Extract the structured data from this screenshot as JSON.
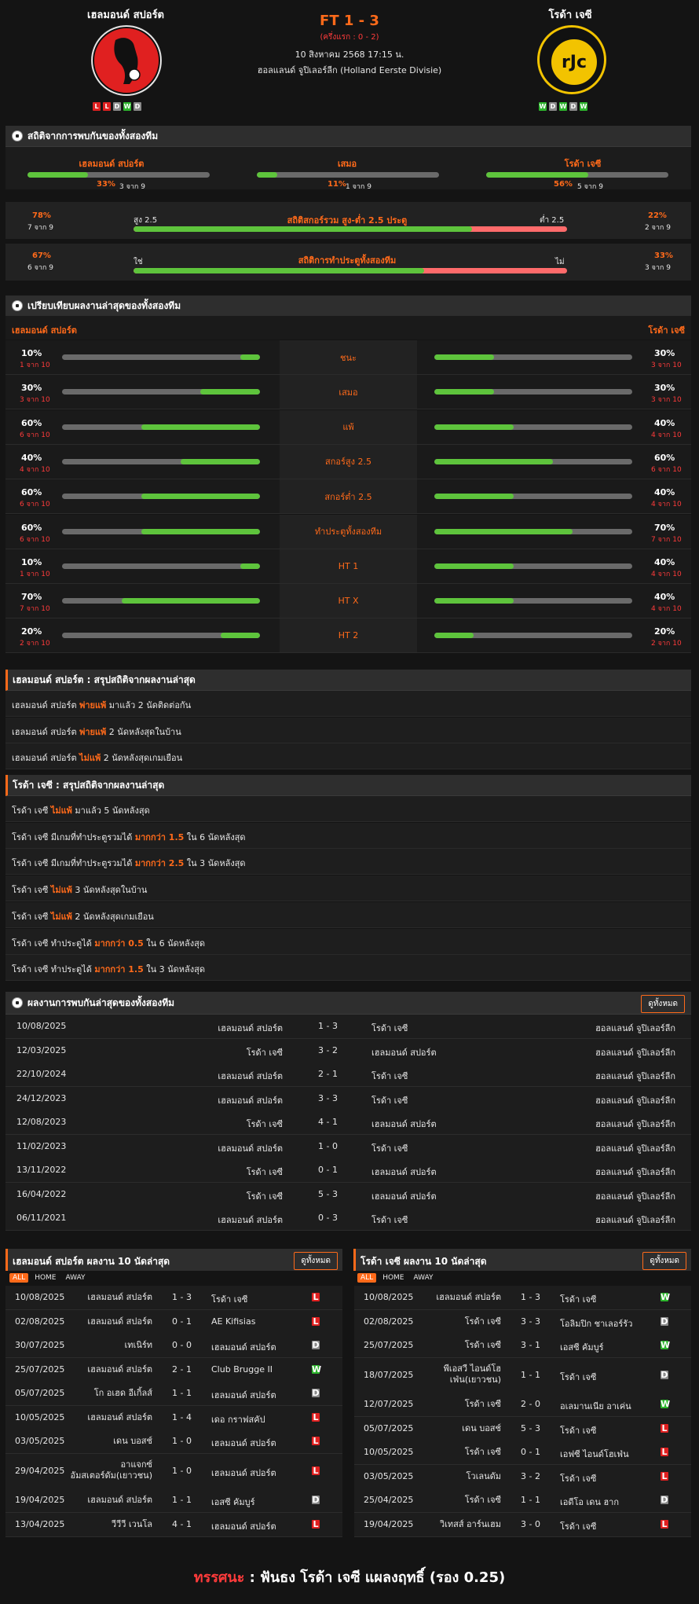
{
  "header": {
    "home": "เฮลมอนด์ สปอร์ต",
    "away": "โรด้า เจซี",
    "score": "FT 1 - 3",
    "half": "(ครึ่งแรก : 0 - 2)",
    "datetime": "10 สิงหาคม 2568 17:15 น.",
    "league": "ฮอลแลนด์ จูปิเลอร์ลีก (Holland Eerste Divisie)",
    "home_form": [
      "L",
      "L",
      "D",
      "W",
      "D"
    ],
    "away_form": [
      "W",
      "D",
      "W",
      "D",
      "W"
    ],
    "away_logo_text": "rJc"
  },
  "h2h": {
    "title": "สถิติจากการพบกันของทั้งสองทีม",
    "home_label": "เฮลมอนด์ สปอร์ต",
    "draw_label": "เสมอ",
    "away_label": "โรด้า เจซี",
    "home_pct": "33%",
    "home_of": "3 จาก 9",
    "home_val": 0.33,
    "draw_pct": "11%",
    "draw_of": "1 จาก 9",
    "draw_val": 0.11,
    "away_pct": "56%",
    "away_of": "5 จาก 9",
    "away_val": 0.56,
    "ou": {
      "left_pct": "78%",
      "left_of": "7 จาก 9",
      "over": "สูง 2.5",
      "title": "สถิติสกอร์รวม สูง-ต่ำ 2.5 ประตู",
      "under": "ต่ำ 2.5",
      "right_pct": "22%",
      "right_of": "2 จาก 9",
      "val": 0.78
    },
    "btts": {
      "left_pct": "67%",
      "left_of": "6 จาก 9",
      "yes": "ใช่",
      "title": "สถิติการทำประตูทั้งสองทีม",
      "no": "ไม่",
      "right_pct": "33%",
      "right_of": "3 จาก 9",
      "val": 0.67
    }
  },
  "compare": {
    "title": "เปรียบเทียบผลงานล่าสุดของทั้งสองทีม",
    "home": "เฮลมอนด์ สปอร์ต",
    "away": "โรด้า เจซี",
    "rows": [
      {
        "label": "ชนะ",
        "hp": "10%",
        "ho": "1 จาก 10",
        "hv": 0.1,
        "ap": "30%",
        "ao": "3 จาก 10",
        "av": 0.3
      },
      {
        "label": "เสมอ",
        "hp": "30%",
        "ho": "3 จาก 10",
        "hv": 0.3,
        "ap": "30%",
        "ao": "3 จาก 10",
        "av": 0.3
      },
      {
        "label": "แพ้",
        "hp": "60%",
        "ho": "6 จาก 10",
        "hv": 0.6,
        "ap": "40%",
        "ao": "4 จาก 10",
        "av": 0.4
      },
      {
        "label": "สกอร์สูง 2.5",
        "hp": "40%",
        "ho": "4 จาก 10",
        "hv": 0.4,
        "ap": "60%",
        "ao": "6 จาก 10",
        "av": 0.6
      },
      {
        "label": "สกอร์ต่ำ 2.5",
        "hp": "60%",
        "ho": "6 จาก 10",
        "hv": 0.6,
        "ap": "40%",
        "ao": "4 จาก 10",
        "av": 0.4
      },
      {
        "label": "ทำประตูทั้งสองทีม",
        "hp": "60%",
        "ho": "6 จาก 10",
        "hv": 0.6,
        "ap": "70%",
        "ao": "7 จาก 10",
        "av": 0.7
      },
      {
        "label": "HT 1",
        "hp": "10%",
        "ho": "1 จาก 10",
        "hv": 0.1,
        "ap": "40%",
        "ao": "4 จาก 10",
        "av": 0.4
      },
      {
        "label": "HT X",
        "hp": "70%",
        "ho": "7 จาก 10",
        "hv": 0.7,
        "ap": "40%",
        "ao": "4 จาก 10",
        "av": 0.4
      },
      {
        "label": "HT 2",
        "hp": "20%",
        "ho": "2 จาก 10",
        "hv": 0.2,
        "ap": "20%",
        "ao": "2 จาก 10",
        "av": 0.2
      }
    ]
  },
  "home_summary": {
    "title": "เฮลมอนด์ สปอร์ต : สรุปสถิติจากผลงานล่าสุด",
    "rows": [
      [
        "เฮลมอนด์ สปอร์ต ",
        "พ่ายแพ้",
        " มาแล้ว 2 นัดติดต่อกัน"
      ],
      [
        "เฮลมอนด์ สปอร์ต ",
        "พ่ายแพ้",
        " 2 นัดหลังสุดในบ้าน"
      ],
      [
        "เฮลมอนด์ สปอร์ต ",
        "ไม่แพ้",
        " 2 นัดหลังสุดเกมเยือน"
      ]
    ]
  },
  "away_summary": {
    "title": "โรด้า เจซี : สรุปสถิติจากผลงานล่าสุด",
    "rows": [
      [
        "โรด้า เจซี ",
        "ไม่แพ้",
        " มาแล้ว 5 นัดหลังสุด"
      ],
      [
        "โรด้า เจซี มีเกมที่ทำประตูรวมได้ ",
        "มากกว่า 1.5",
        " ใน 6 นัดหลังสุด"
      ],
      [
        "โรด้า เจซี มีเกมที่ทำประตูรวมได้ ",
        "มากกว่า 2.5",
        " ใน 3 นัดหลังสุด"
      ],
      [
        "โรด้า เจซี ",
        "ไม่แพ้",
        " 3 นัดหลังสุดในบ้าน"
      ],
      [
        "โรด้า เจซี ",
        "ไม่แพ้",
        " 2 นัดหลังสุดเกมเยือน"
      ],
      [
        "โรด้า เจซี ทำประตูได้ ",
        "มากกว่า 0.5",
        " ใน 6 นัดหลังสุด"
      ],
      [
        "โรด้า เจซี ทำประตูได้ ",
        "มากกว่า 1.5",
        " ใน 3 นัดหลังสุด"
      ]
    ]
  },
  "meetings": {
    "title": "ผลงานการพบกันล่าสุดของทั้งสองทีม",
    "view_all": "ดูทั้งหมด",
    "rows": [
      [
        "10/08/2025",
        "เฮลมอนด์ สปอร์ต",
        "1 - 3",
        "โรด้า เจซี",
        "ฮอลแลนด์ จูปิเลอร์ลีก"
      ],
      [
        "12/03/2025",
        "โรด้า เจซี",
        "3 - 2",
        "เฮลมอนด์ สปอร์ต",
        "ฮอลแลนด์ จูปิเลอร์ลีก"
      ],
      [
        "22/10/2024",
        "เฮลมอนด์ สปอร์ต",
        "2 - 1",
        "โรด้า เจซี",
        "ฮอลแลนด์ จูปิเลอร์ลีก"
      ],
      [
        "24/12/2023",
        "เฮลมอนด์ สปอร์ต",
        "3 - 3",
        "โรด้า เจซี",
        "ฮอลแลนด์ จูปิเลอร์ลีก"
      ],
      [
        "12/08/2023",
        "โรด้า เจซี",
        "4 - 1",
        "เฮลมอนด์ สปอร์ต",
        "ฮอลแลนด์ จูปิเลอร์ลีก"
      ],
      [
        "11/02/2023",
        "เฮลมอนด์ สปอร์ต",
        "1 - 0",
        "โรด้า เจซี",
        "ฮอลแลนด์ จูปิเลอร์ลีก"
      ],
      [
        "13/11/2022",
        "โรด้า เจซี",
        "0 - 1",
        "เฮลมอนด์ สปอร์ต",
        "ฮอลแลนด์ จูปิเลอร์ลีก"
      ],
      [
        "16/04/2022",
        "โรด้า เจซี",
        "5 - 3",
        "เฮลมอนด์ สปอร์ต",
        "ฮอลแลนด์ จูปิเลอร์ลีก"
      ],
      [
        "06/11/2021",
        "เฮลมอนด์ สปอร์ต",
        "0 - 3",
        "โรด้า เจซี",
        "ฮอลแลนด์ จูปิเลอร์ลีก"
      ]
    ]
  },
  "home_last": {
    "title": "เฮลมอนด์ สปอร์ต ผลงาน 10 นัดล่าสุด",
    "view_all": "ดูทั้งหมด",
    "tabs": [
      "ALL",
      "HOME",
      "AWAY"
    ],
    "rows": [
      [
        "10/08/2025",
        "เฮลมอนด์ สปอร์ต",
        "1 - 3",
        "โรด้า เจซี",
        "L"
      ],
      [
        "02/08/2025",
        "เฮลมอนด์ สปอร์ต",
        "0 - 1",
        "AE Kifisias",
        "L"
      ],
      [
        "30/07/2025",
        "เทเนิร์ท",
        "0 - 0",
        "เฮลมอนด์ สปอร์ต",
        "D"
      ],
      [
        "25/07/2025",
        "เฮลมอนด์ สปอร์ต",
        "2 - 1",
        "Club Brugge II",
        "W"
      ],
      [
        "05/07/2025",
        "โก อเฮด อีเกิ้ลส์",
        "1 - 1",
        "เฮลมอนด์ สปอร์ต",
        "D"
      ],
      [
        "10/05/2025",
        "เฮลมอนด์ สปอร์ต",
        "1 - 4",
        "เดอ กราฟสคัป",
        "L"
      ],
      [
        "03/05/2025",
        "เดน บอสช์",
        "1 - 0",
        "เฮลมอนด์ สปอร์ต",
        "L"
      ],
      [
        "29/04/2025",
        "อาแจกซ์ อัมสเตอร์ดัม(เยาวชน)",
        "1 - 0",
        "เฮลมอนด์ สปอร์ต",
        "L"
      ],
      [
        "19/04/2025",
        "เฮลมอนด์ สปอร์ต",
        "1 - 1",
        "เอสซี คัมบูร์",
        "D"
      ],
      [
        "13/04/2025",
        "วีวีวี เวนโล",
        "4 - 1",
        "เฮลมอนด์ สปอร์ต",
        "L"
      ]
    ]
  },
  "away_last": {
    "title": "โรด้า เจซี ผลงาน 10 นัดล่าสุด",
    "view_all": "ดูทั้งหมด",
    "tabs": [
      "ALL",
      "HOME",
      "AWAY"
    ],
    "rows": [
      [
        "10/08/2025",
        "เฮลมอนด์ สปอร์ต",
        "1 - 3",
        "โรด้า เจซี",
        "W"
      ],
      [
        "02/08/2025",
        "โรด้า เจซี",
        "3 - 3",
        "โอลิมปิก ชาเลอร์รัว",
        "D"
      ],
      [
        "25/07/2025",
        "โรด้า เจซี",
        "3 - 1",
        "เอสซี คัมบูร์",
        "W"
      ],
      [
        "18/07/2025",
        "พีเอสวี ไอนด์โฮเฟ่น(เยาวชน)",
        "1 - 1",
        "โรด้า เจซี",
        "D"
      ],
      [
        "12/07/2025",
        "โรด้า เจซี",
        "2 - 0",
        "อเลมานเนีย อาเค่น",
        "W"
      ],
      [
        "05/07/2025",
        "เดน บอสช์",
        "5 - 3",
        "โรด้า เจซี",
        "L"
      ],
      [
        "10/05/2025",
        "โรด้า เจซี",
        "0 - 1",
        "เอฟซี ไอนด์โฮเฟ่น",
        "L"
      ],
      [
        "03/05/2025",
        "โวเลนดัม",
        "3 - 2",
        "โรด้า เจซี",
        "L"
      ],
      [
        "25/04/2025",
        "โรด้า เจซี",
        "1 - 1",
        "เอดีโอ เดน ฮาก",
        "D"
      ],
      [
        "19/04/2025",
        "วิเทสส์ อาร์นเฮม",
        "3 - 0",
        "โรด้า เจซี",
        "L"
      ]
    ]
  },
  "prediction": {
    "label": "ทรรศนะ",
    "colon": ":",
    "text": "ฟันธง โรด้า เจซี แผลงฤทธิ์ (รอง 0.25)"
  },
  "colors": {
    "accent": "#ff6a1a",
    "win": "#2db52d",
    "draw": "#8a8a8a",
    "loss": "#e02020",
    "bar_green": "#5ec43c"
  }
}
